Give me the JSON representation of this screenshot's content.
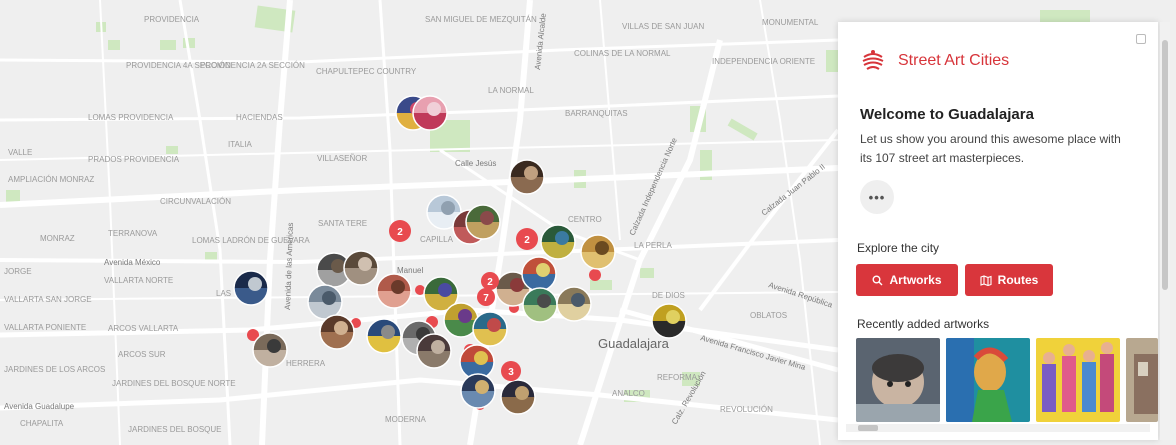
{
  "map": {
    "labels": {
      "providencia": "PROVIDENCIA",
      "prov_4": "PROVIDENCIA 4A SECCIÓN",
      "prov_2": "PROVIDENCIA 2A SECCIÓN",
      "lomas_prov": "LOMAS PROVIDENCIA",
      "chapultepec_country": "CHAPULTEPEC COUNTRY",
      "san_miguel": "SAN MIGUEL DE MEZQUITÁN",
      "villas_san_juan": "VILLAS DE SAN JUAN",
      "monumental": "MONUMENTAL",
      "colinas": "COLINAS DE LA NORMAL",
      "la_normal": "LA NORMAL",
      "independencia": "INDEPENDENCIA ORIENTE",
      "haciendas": "HACIENDAS",
      "barranquitas": "BARRANQUITAS",
      "italia": "ITALIA",
      "valle": "VALLE",
      "prados_providencia": "PRADOS PROVIDENCIA",
      "villasenor": "VILLASEÑOR",
      "ampliacion": "AMPLIACIÓN MONRAZ",
      "circunvalacion": "CIRCUNVALACIÓN",
      "monraz": "MONRAZ",
      "terranova": "TERRANOVA",
      "lomas_guevara": "LOMAS LADRÓN DE GUEVARA",
      "santa_tere": "SANTA TERE",
      "capilla": "CAPILLA",
      "centro": "CENTRO",
      "la_perla": "LA PERLA",
      "oblatos": "OBLATOS",
      "vallarta_norte": "VALLARTA NORTE",
      "jorge": "JORGE",
      "vallarta_san_jorge": "VALLARTA SAN JORGE",
      "vallarta_poniente": "VALLARTA PONIENTE",
      "arcos_vallarta": "ARCOS VALLARTA",
      "arcos_sur": "ARCOS SUR",
      "jardines_arcos": "JARDINES DE LOS ARCOS",
      "jardines_bosque": "JARDINES DEL BOSQUE NORTE",
      "jardines_del": "JARDINES DEL BOSQUE",
      "chapalita": "CHAPALITA",
      "moderna": "MODERNA",
      "reforma": "REFORMA",
      "revolucion": "REVOLUCIÓN",
      "las": "LAS",
      "guadalajara": "Guadalajara",
      "herrera": "HERRERA",
      "mexicaltzingo": "ANALCO",
      "dios": "DE DIOS",
      "av_mexico": "Avenida México",
      "av_guadalupe": "Avenida Guadalupe",
      "av_americas": "Avenida de las Américas",
      "calle_jesus": "Calle Jesús",
      "calzada_indep": "Calzada Independencia Norte",
      "calzada_juan_pablo": "Calzada Juan Pablo II",
      "av_republica": "Avenida República",
      "av_javier_mina": "Avenida Francisco Javier Mina",
      "av_alcalde": "Avenida Alcalde",
      "calz_revolucion": "Calz. Revolución",
      "manuel": "Manuel"
    },
    "cluster_counts": [
      "2",
      "2",
      "2",
      "7",
      "3"
    ]
  },
  "panel": {
    "brand": "Street Art Cities",
    "welcome": "Welcome to Guadalajara",
    "intro": "Let us show you around this awesome place with its 107 street art masterpieces.",
    "more": "•••",
    "explore": "Explore the city",
    "artworks_btn": "Artworks",
    "routes_btn": "Routes",
    "recent": "Recently added artworks"
  },
  "colors": {
    "brand": "#d7343a",
    "button": "#d9363c",
    "park": "#cfe8c0",
    "road": "#ffffff"
  }
}
